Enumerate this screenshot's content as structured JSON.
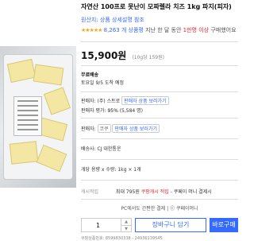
{
  "product": {
    "title": "자연산 100프로 못난이 모짜렐라 치즈 1kg 파지(피자)",
    "shop_label": "원산지: 상품 상세설명 참조",
    "stars": "★★★★★",
    "review_count": "8,263 개 상품평",
    "bought_text": "지난 한 달 동안 ",
    "bought_highlight": "1만명 이상",
    "bought_suffix": " 구매했어요",
    "price": "15,900원",
    "unit_price": "(10g당 159원)"
  },
  "shipping": {
    "title": "무료배송",
    "arrival": "토요일 9/5 도착 예정"
  },
  "seller": {
    "label": "판매자: (주) 스트로",
    "tag1": "판매자 상품 보러가기",
    "rating_label": "판매자 평가:",
    "rating_value": "95%",
    "rating_count": "(5,584 명)"
  },
  "option_row": {
    "label": "판매자:",
    "tag_left": "코쿠",
    "tag_right": "판매자 상품 보러가기"
  },
  "delivery": {
    "label": "배송사:",
    "value": "CJ 대한통운"
  },
  "quantity_unit": {
    "label": "개당 용량 x 수량:",
    "value": "1kg × 1개"
  },
  "cash": {
    "label": "캐시적립",
    "prefix": "최대 795원 ",
    "highlight": "쿠팡캐시 적립",
    "suffix": " - 쿠페이 머니 결제시"
  },
  "pay_line": "PC에서도 간편한 결제 | ⓒ 쿠페이머니",
  "purchase": {
    "quantity": "1",
    "up_arrow": "▲",
    "down_arrow": "▼",
    "cart_label": "장바구니 담기",
    "buy_label": "바로구매"
  },
  "footer": "쿠팡상품번호: 8599830338 - 24936139545",
  "colors": {
    "accent": "#346aff",
    "highlight_red": "#e52528",
    "star": "#f5a623"
  }
}
